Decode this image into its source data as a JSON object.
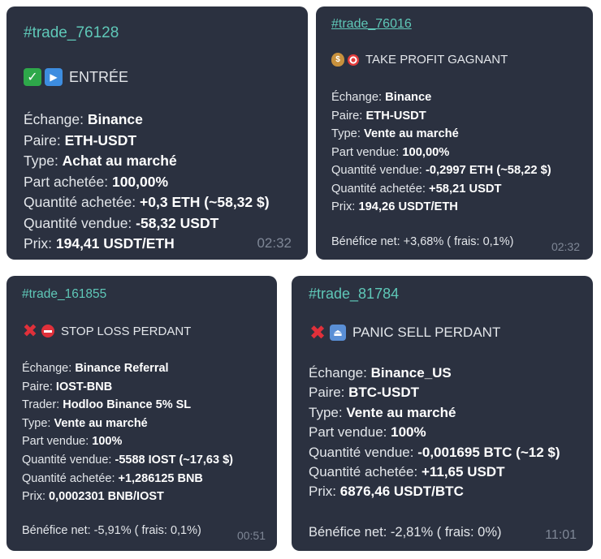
{
  "cards": [
    {
      "tag": "#trade_76128",
      "icons": [
        "check-icon",
        "play-icon"
      ],
      "title": "ENTRÉE",
      "rows": [
        {
          "label": "Échange: ",
          "value": "Binance"
        },
        {
          "label": "Paire: ",
          "value": "ETH-USDT"
        },
        {
          "label": "Type: ",
          "value": "Achat au marché"
        },
        {
          "label": "Part achetée: ",
          "value": "100,00%"
        },
        {
          "label": "Quantité achetée: ",
          "value": "+0,3 ETH (~58,32 $)"
        },
        {
          "label": "Quantité vendue: ",
          "value": "-58,32 USDT"
        },
        {
          "label": "Prix: ",
          "value": "194,41 USDT/ETH"
        }
      ],
      "time": "02:32"
    },
    {
      "tag": "#trade_76016",
      "icons": [
        "money-bag-icon",
        "target-icon"
      ],
      "title": "TAKE PROFIT GAGNANT",
      "rows": [
        {
          "label": "Échange: ",
          "value": "Binance"
        },
        {
          "label": "Paire: ",
          "value": "ETH-USDT"
        },
        {
          "label": "Type: ",
          "value": "Vente au marché"
        },
        {
          "label": "Part vendue: ",
          "value": "100,00%"
        },
        {
          "label": "Quantité vendue: ",
          "value": "-0,2997 ETH (~58,22 $)"
        },
        {
          "label": "Quantité achetée: ",
          "value": "+58,21 USDT"
        },
        {
          "label": "Prix: ",
          "value": "194,26 USDT/ETH"
        }
      ],
      "profit": "Bénéfice net: +3,68% ( frais: 0,1%)",
      "time": "02:32"
    },
    {
      "tag": "#trade_161855",
      "icons": [
        "cross-icon",
        "no-entry-icon"
      ],
      "title": "STOP LOSS PERDANT",
      "rows": [
        {
          "label": "Échange: ",
          "value": "Binance Referral"
        },
        {
          "label": "Paire: ",
          "value": "IOST-BNB"
        },
        {
          "label": "Trader: ",
          "value": "Hodloo Binance 5% SL"
        },
        {
          "label": "Type: ",
          "value": "Vente au marché"
        },
        {
          "label": "Part vendue: ",
          "value": "100%"
        },
        {
          "label": "Quantité vendue: ",
          "value": "-5588 IOST (~17,63 $)"
        },
        {
          "label": "Quantité achetée: ",
          "value": "+1,286125 BNB"
        },
        {
          "label": "Prix: ",
          "value": "0,0002301 BNB/IOST"
        }
      ],
      "profit": "Bénéfice net: -5,91% ( frais: 0,1%)",
      "time": "00:51"
    },
    {
      "tag": "#trade_81784",
      "icons": [
        "cross-icon",
        "eject-icon"
      ],
      "title": "PANIC SELL PERDANT",
      "rows": [
        {
          "label": "Échange: ",
          "value": "Binance_US"
        },
        {
          "label": "Paire: ",
          "value": "BTC-USDT"
        },
        {
          "label": "Type: ",
          "value": "Vente au marché"
        },
        {
          "label": "Part vendue: ",
          "value": "100%"
        },
        {
          "label": "Quantité vendue: ",
          "value": "-0,001695 BTC (~12 $)"
        },
        {
          "label": "Quantité achetée: ",
          "value": "+11,65 USDT"
        },
        {
          "label": "Prix: ",
          "value": "6876,46 USDT/BTC"
        }
      ],
      "profit": "Bénéfice net: -2,81% ( frais: 0%)",
      "time": "11:01"
    }
  ]
}
